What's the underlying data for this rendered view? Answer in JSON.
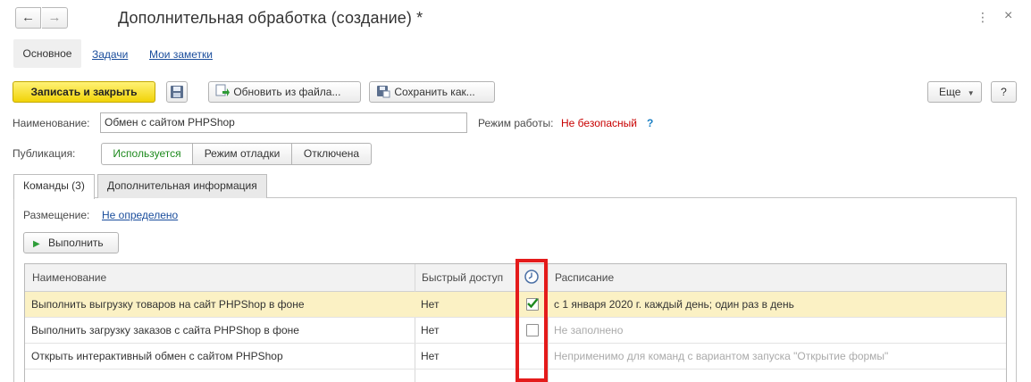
{
  "window": {
    "title": "Дополнительная обработка (создание) *",
    "nav_back": "←",
    "nav_forward": "→",
    "more": "⋮",
    "close": "×"
  },
  "sections": {
    "main": "Основное",
    "tasks": "Задачи",
    "notes": "Мои заметки"
  },
  "toolbar": {
    "save_close": "Записать и закрыть",
    "update_from_file": "Обновить из файла...",
    "save_as": "Сохранить как...",
    "more": "Еще",
    "help": "?"
  },
  "form": {
    "name_label": "Наименование:",
    "name_value": "Обмен с сайтом PHPShop",
    "mode_label": "Режим работы:",
    "mode_value": "Не безопасный",
    "mode_help": "?",
    "publication_label": "Публикация:",
    "publication_options": [
      "Используется",
      "Режим отладки",
      "Отключена"
    ]
  },
  "tabs": {
    "commands": "Команды (3)",
    "additional": "Дополнительная информация"
  },
  "commands": {
    "placement_label": "Размещение:",
    "placement_value": "Не определено",
    "run_button": "Выполнить",
    "columns": {
      "name": "Наименование",
      "quick_access": "Быстрый доступ",
      "schedule": "Расписание"
    },
    "rows": [
      {
        "name": "Выполнить выгрузку товаров на сайт PHPShop в фоне",
        "quick": "Нет",
        "schedule": "с 1 января 2020 г. каждый день; один раз в день"
      },
      {
        "name": "Выполнить загрузку заказов с сайта PHPShop в фоне",
        "quick": "Нет",
        "schedule": "Не заполнено"
      },
      {
        "name": "Открыть интерактивный обмен с сайтом PHPShop",
        "quick": "Нет",
        "schedule": "Неприменимо для команд с вариантом запуска \"Открытие формы\""
      }
    ]
  },
  "colors": {
    "accent_yellow": "#f1d307",
    "link_blue": "#1a4d9c",
    "danger_red": "#c80000",
    "highlight_red": "#e41b1b",
    "selected_row": "#fbf1c4",
    "check_green": "#1e8a1e"
  }
}
